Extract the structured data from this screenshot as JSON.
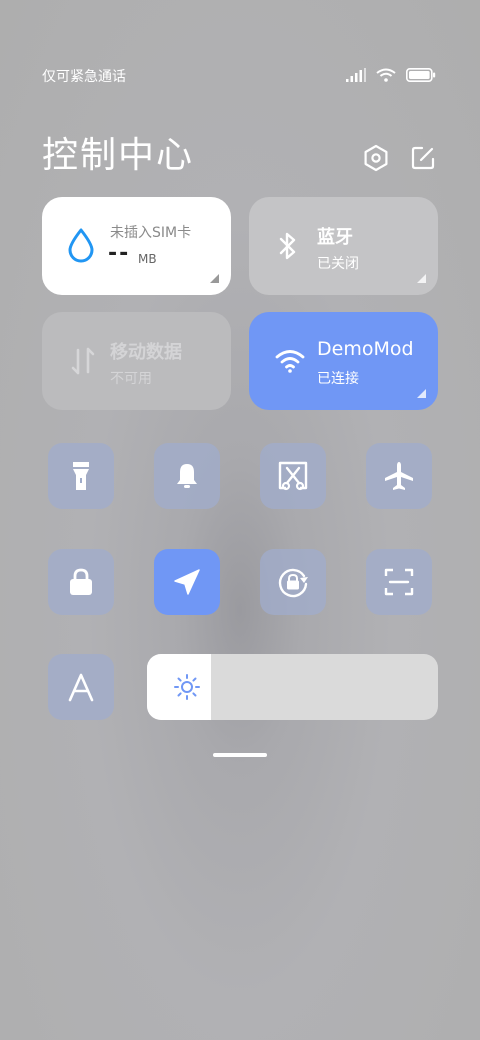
{
  "status_bar": {
    "carrier": "仅可紧急通话",
    "battery_level": 1.0
  },
  "header": {
    "title": "控制中心"
  },
  "tiles": {
    "data_usage": {
      "label": "未插入SIM卡",
      "value": "--",
      "unit": "MB",
      "icon": "water-drop-icon"
    },
    "bluetooth": {
      "label": "蓝牙",
      "status": "已关闭",
      "icon": "bluetooth-icon",
      "enabled": false
    },
    "mobile_data": {
      "label": "移动数据",
      "status": "不可用",
      "icon": "data-arrows-icon",
      "enabled": false
    },
    "wifi": {
      "label": "DemoMod",
      "status": "已连接",
      "icon": "wifi-icon",
      "enabled": true
    }
  },
  "toggles": [
    {
      "name": "flashlight",
      "icon": "flashlight-icon",
      "active": false
    },
    {
      "name": "silent",
      "icon": "bell-icon",
      "active": false
    },
    {
      "name": "screenshot",
      "icon": "screenshot-scissors-icon",
      "active": false
    },
    {
      "name": "airplane",
      "icon": "airplane-icon",
      "active": false
    },
    {
      "name": "lock-screen",
      "icon": "lock-icon",
      "active": false
    },
    {
      "name": "location",
      "icon": "location-arrow-icon",
      "active": true
    },
    {
      "name": "rotation-lock",
      "icon": "rotation-lock-icon",
      "active": false
    },
    {
      "name": "scanner",
      "icon": "scan-icon",
      "active": false
    },
    {
      "name": "font-size",
      "icon": "font-a-icon",
      "active": false
    }
  ],
  "brightness": {
    "level": 0.22,
    "icon": "sun-icon"
  },
  "colors": {
    "accent": "#7097f5",
    "tile_active_bg": "#ffffff",
    "tile_inactive_bg": "#c4c4c6",
    "drop_blue": "#2196f3"
  }
}
